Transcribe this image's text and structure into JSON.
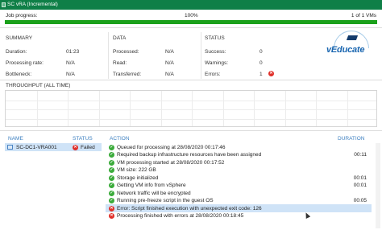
{
  "window": {
    "title": "SC vRA (Incremental)"
  },
  "progress": {
    "label": "Job progress:",
    "percent_text": "100%",
    "count_text": "1 of 1 VMs",
    "fraction": 1.0
  },
  "summary": {
    "title": "SUMMARY",
    "duration_label": "Duration:",
    "duration_value": "01:23",
    "rate_label": "Processing rate:",
    "rate_value": "N/A",
    "bottleneck_label": "Bottleneck:",
    "bottleneck_value": "N/A"
  },
  "data": {
    "title": "DATA",
    "processed_label": "Processed:",
    "processed_value": "N/A",
    "read_label": "Read:",
    "read_value": "N/A",
    "transferred_label": "Transferred:",
    "transferred_value": "N/A"
  },
  "status": {
    "title": "STATUS",
    "success_label": "Success:",
    "success_value": "0",
    "warnings_label": "Warnings:",
    "warnings_value": "0",
    "errors_label": "Errors:",
    "errors_value": "1"
  },
  "logo": {
    "text": "vEducate"
  },
  "throughput": {
    "title": "THROUGHPUT (ALL TIME)"
  },
  "vm_list": {
    "name_header": "NAME",
    "status_header": "STATUS",
    "rows": [
      {
        "name": "SC-DC1-VRA001",
        "status": "Failed"
      }
    ]
  },
  "log": {
    "action_header": "ACTION",
    "duration_header": "DURATION",
    "rows": [
      {
        "status": "ok",
        "action": "Queued for processing at 28/08/2020 00:17:46",
        "duration": ""
      },
      {
        "status": "ok",
        "action": "Required backup infrastructure resources have been assigned",
        "duration": "00:11"
      },
      {
        "status": "ok",
        "action": "VM processing started at 28/08/2020 00:17:52",
        "duration": ""
      },
      {
        "status": "ok",
        "action": "VM size: 222 GB",
        "duration": ""
      },
      {
        "status": "ok",
        "action": "Storage initialized",
        "duration": "00:01"
      },
      {
        "status": "ok",
        "action": "Getting VM info from vSphere",
        "duration": "00:01"
      },
      {
        "status": "ok",
        "action": "Network traffic will be encrypted",
        "duration": ""
      },
      {
        "status": "ok",
        "action": "Running pre-freeze script in the guest OS",
        "duration": "00:05"
      },
      {
        "status": "error",
        "action": "Error: Script finished execution with unexpected exit code: 126",
        "duration": ""
      },
      {
        "status": "error",
        "action": "Processing finished with errors at 28/08/2020 00:18:45",
        "duration": ""
      }
    ]
  }
}
